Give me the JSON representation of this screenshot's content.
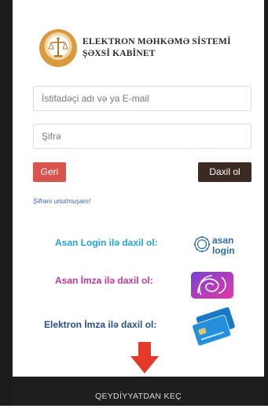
{
  "header": {
    "title_line1": "ELEKTRON MƏHKƏMƏ SİSTEMİ",
    "title_line2": "ŞƏXSİ KABİNET"
  },
  "form": {
    "username_placeholder": "İstifadəçi adı və ya E-mail",
    "password_placeholder": "Şifrə",
    "back_label": "Geri",
    "login_label": "Daxil ol",
    "forgot_label": "Şifrəni unutmuşam!"
  },
  "login_options": [
    {
      "label": "Asan Login ilə daxil ol:",
      "logo_text_1": "asan",
      "logo_text_2": "login",
      "icon": "asan-login-logo-icon",
      "color": "#1fa6d6"
    },
    {
      "label": "Asan İmza ilə daxil ol:",
      "icon": "asan-imza-logo-icon",
      "color": "#c3379a"
    },
    {
      "label": "Elektron İmza ilə daxil ol:",
      "icon": "smart-card-icon",
      "color": "#2b4f8a"
    }
  ],
  "footer": {
    "register_label": "QEYDİYYATDAN KEÇ"
  },
  "colors": {
    "back_button": "#d9534f",
    "login_button": "#3b2a22",
    "arrow": "#e53a2a",
    "footer_bg": "#1e1e1e"
  }
}
